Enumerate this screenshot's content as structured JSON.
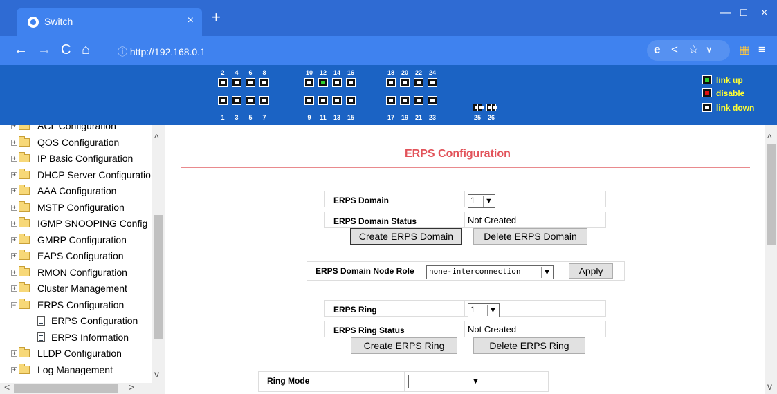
{
  "browser": {
    "tab_title": "Switch",
    "tab_close": "×",
    "new_tab": "+",
    "url_prefix": "ⓘ ",
    "url": "http://192.168.0.1",
    "window_controls": {
      "minimize": "—",
      "maximize": "□",
      "close": "×"
    }
  },
  "banner": {
    "top_ports": [
      "2",
      "4",
      "6",
      "8",
      "10",
      "12",
      "14",
      "16",
      "18",
      "20",
      "22",
      "24"
    ],
    "bottom_ports": [
      "1",
      "3",
      "5",
      "7",
      "9",
      "11",
      "13",
      "15",
      "17",
      "19",
      "21",
      "23"
    ],
    "sfp_ports": [
      "25",
      "26"
    ],
    "link_up_port": "12",
    "legend": {
      "link_up": "link up",
      "disable": "disable",
      "link_down": "link down"
    },
    "colors": {
      "link_up": "#2fcf2f",
      "disable": "#e01010",
      "link_down": "#ffffff",
      "legend_text": "#ffff33",
      "banner_bg": "#1b63c4"
    }
  },
  "sidebar": {
    "items": [
      {
        "label": "ACL Configuration"
      },
      {
        "label": "QOS Configuration"
      },
      {
        "label": "IP Basic Configuration"
      },
      {
        "label": "DHCP Server Configuratio"
      },
      {
        "label": "AAA Configuration"
      },
      {
        "label": "MSTP Configuration"
      },
      {
        "label": "IGMP SNOOPING Config"
      },
      {
        "label": "GMRP Configuration"
      },
      {
        "label": "EAPS Configuration"
      },
      {
        "label": "RMON Configuration"
      },
      {
        "label": "Cluster Management"
      },
      {
        "label": "ERPS Configuration"
      },
      {
        "label": "ERPS Configuration"
      },
      {
        "label": "ERPS Information"
      },
      {
        "label": "LLDP Configuration"
      },
      {
        "label": "Log Management"
      }
    ]
  },
  "main": {
    "title": "ERPS Configuration",
    "domain": {
      "label": "ERPS Domain",
      "value": "1",
      "status_label": "ERPS Domain Status",
      "status_value": "Not Created",
      "create_button": "Create ERPS Domain",
      "delete_button": "Delete ERPS Domain"
    },
    "node_role": {
      "label": "ERPS Domain Node Role",
      "value": "none-interconnection",
      "apply_button": "Apply"
    },
    "ring": {
      "label": "ERPS Ring",
      "value": "1",
      "status_label": "ERPS Ring Status",
      "status_value": "Not Created",
      "create_button": "Create ERPS Ring",
      "delete_button": "Delete ERPS Ring"
    },
    "ring_mode": {
      "label": "Ring Mode",
      "value": ""
    }
  }
}
